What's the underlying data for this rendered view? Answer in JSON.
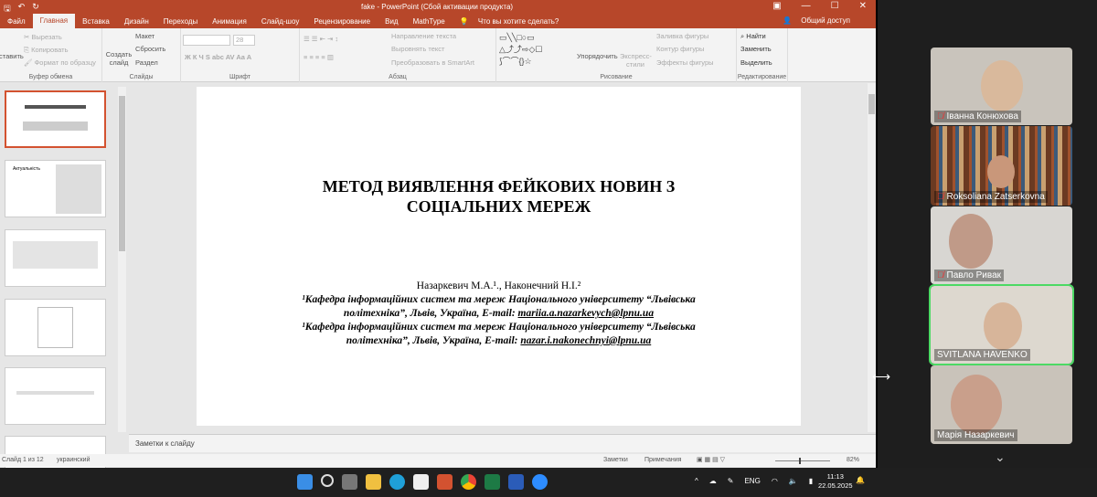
{
  "window": {
    "title": "fake - PowerPoint (Сбой активации продукта)",
    "share": "Общий доступ"
  },
  "tabs": [
    "Файл",
    "Главная",
    "Вставка",
    "Дизайн",
    "Переходы",
    "Анимация",
    "Слайд-шоу",
    "Рецензирование",
    "Вид",
    "MathType"
  ],
  "tell_me": "Что вы хотите сделать?",
  "ribbon": {
    "clipboard": {
      "label": "Буфер обмена",
      "paste": "Вставить",
      "cut": "Вырезать",
      "copy": "Копировать",
      "format": "Формат по образцу"
    },
    "slides": {
      "label": "Слайды",
      "new": "Создать слайд",
      "layout": "Макет",
      "reset": "Сбросить",
      "section": "Раздел"
    },
    "font": {
      "label": "Шрифт",
      "size": "28"
    },
    "paragraph": {
      "label": "Абзац",
      "dir": "Направление текста",
      "align": "Выровнять текст",
      "smartart": "Преобразовать в SmartArt"
    },
    "drawing": {
      "label": "Рисование",
      "arrange": "Упорядочить",
      "styles": "Экспресс-стили",
      "fill": "Заливка фигуры",
      "outline": "Контур фигуры",
      "effects": "Эффекты фигуры"
    },
    "editing": {
      "label": "Редактирование",
      "find": "Найти",
      "replace": "Заменить",
      "select": "Выделить"
    }
  },
  "slide": {
    "title_line1": "МЕТОД ВИЯВЛЕННЯ ФЕЙКОВИХ НОВИН З",
    "title_line2": "СОЦІАЛЬНИХ МЕРЕЖ",
    "authors": "Назаркевич М.А.¹., Наконечний  Н.І.²",
    "aff1_a": "¹Кафедра інформаційних систем та мереж Національного університету “Львівська",
    "aff1_b": "політехніка”, Львів, Україна, E-mail: ",
    "email1": "mariia.a.nazarkevych@lpnu.ua",
    "aff2_a": "¹Кафедра інформаційних систем та мереж Національного університету “Львівська",
    "aff2_b": "політехніка”, Львів, Україна, E-mail: ",
    "email2": "nazar.i.nakonechnyi@lpnu.ua"
  },
  "thumb2_title": "Актуальність",
  "notes_placeholder": "Заметки к слайду",
  "status": {
    "slide": "Слайд 1 из 12",
    "lang": "украинский",
    "notes": "Заметки",
    "comments": "Примечания",
    "zoom": "82%"
  },
  "taskbar": {
    "lang": "ENG",
    "time": "11:13",
    "date": "22.05.2025"
  },
  "participants": [
    {
      "name": "Іванна Конюхова",
      "muted": true
    },
    {
      "name": "Roksoliana Zatserkovna",
      "muted": true
    },
    {
      "name": "Павло Ривак",
      "muted": true
    },
    {
      "name": "SVITLANA HAVENKO",
      "muted": false
    },
    {
      "name": "Марія Назаркевич",
      "muted": false
    }
  ]
}
